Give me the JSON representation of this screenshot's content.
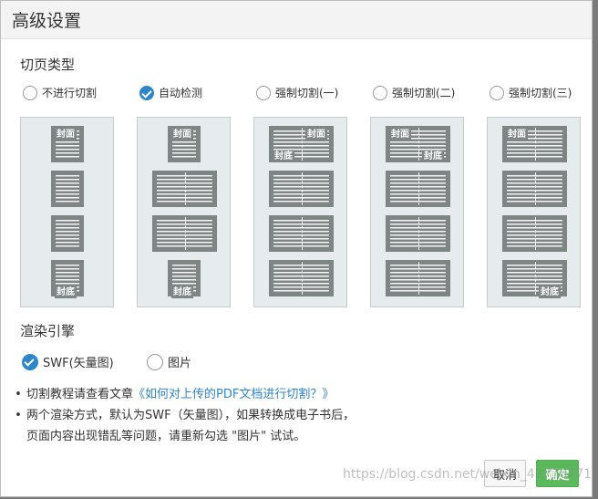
{
  "dialog": {
    "title": "高级设置"
  },
  "paging": {
    "section_title": "切页类型",
    "options": [
      {
        "label": "不进行切割",
        "checked": false
      },
      {
        "label": "自动检测",
        "checked": true
      },
      {
        "label": "强制切割(一)",
        "checked": false
      },
      {
        "label": "强制切割(二)",
        "checked": false
      },
      {
        "label": "强制切割(三)",
        "checked": false
      }
    ],
    "cover_label": "封面",
    "back_label": "封底"
  },
  "render": {
    "section_title": "渲染引擎",
    "options": [
      {
        "label": "SWF(矢量图)",
        "checked": true
      },
      {
        "label": "图片",
        "checked": false
      }
    ]
  },
  "notes": {
    "line1_prefix": "切割教程请查看文章",
    "line1_link": "《如何对上传的PDF文档进行切割？》",
    "line2": "两个渲染方式，默认为SWF（矢量图），如果转换成电子书后，",
    "line3": "页面内容出现错乱等问题，请重新勾选 \"图片\" 试试。"
  },
  "buttons": {
    "cancel": "取消",
    "ok": "确定"
  },
  "watermark": "https://blog.csdn.net/weixin_43770771",
  "colors": {
    "accent": "#2e86c9",
    "ok_button": "#5cb85c",
    "page_gray": "#7d8585"
  }
}
